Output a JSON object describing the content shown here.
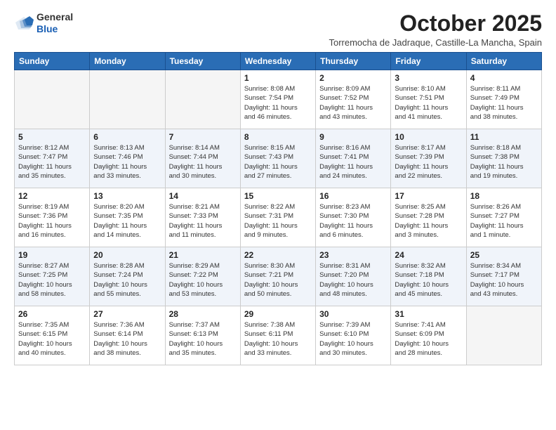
{
  "logo": {
    "general": "General",
    "blue": "Blue"
  },
  "title": "October 2025",
  "location": "Torremocha de Jadraque, Castille-La Mancha, Spain",
  "headers": [
    "Sunday",
    "Monday",
    "Tuesday",
    "Wednesday",
    "Thursday",
    "Friday",
    "Saturday"
  ],
  "weeks": [
    [
      {
        "day": "",
        "lines": []
      },
      {
        "day": "",
        "lines": []
      },
      {
        "day": "",
        "lines": []
      },
      {
        "day": "1",
        "lines": [
          "Sunrise: 8:08 AM",
          "Sunset: 7:54 PM",
          "Daylight: 11 hours",
          "and 46 minutes."
        ]
      },
      {
        "day": "2",
        "lines": [
          "Sunrise: 8:09 AM",
          "Sunset: 7:52 PM",
          "Daylight: 11 hours",
          "and 43 minutes."
        ]
      },
      {
        "day": "3",
        "lines": [
          "Sunrise: 8:10 AM",
          "Sunset: 7:51 PM",
          "Daylight: 11 hours",
          "and 41 minutes."
        ]
      },
      {
        "day": "4",
        "lines": [
          "Sunrise: 8:11 AM",
          "Sunset: 7:49 PM",
          "Daylight: 11 hours",
          "and 38 minutes."
        ]
      }
    ],
    [
      {
        "day": "5",
        "lines": [
          "Sunrise: 8:12 AM",
          "Sunset: 7:47 PM",
          "Daylight: 11 hours",
          "and 35 minutes."
        ]
      },
      {
        "day": "6",
        "lines": [
          "Sunrise: 8:13 AM",
          "Sunset: 7:46 PM",
          "Daylight: 11 hours",
          "and 33 minutes."
        ]
      },
      {
        "day": "7",
        "lines": [
          "Sunrise: 8:14 AM",
          "Sunset: 7:44 PM",
          "Daylight: 11 hours",
          "and 30 minutes."
        ]
      },
      {
        "day": "8",
        "lines": [
          "Sunrise: 8:15 AM",
          "Sunset: 7:43 PM",
          "Daylight: 11 hours",
          "and 27 minutes."
        ]
      },
      {
        "day": "9",
        "lines": [
          "Sunrise: 8:16 AM",
          "Sunset: 7:41 PM",
          "Daylight: 11 hours",
          "and 24 minutes."
        ]
      },
      {
        "day": "10",
        "lines": [
          "Sunrise: 8:17 AM",
          "Sunset: 7:39 PM",
          "Daylight: 11 hours",
          "and 22 minutes."
        ]
      },
      {
        "day": "11",
        "lines": [
          "Sunrise: 8:18 AM",
          "Sunset: 7:38 PM",
          "Daylight: 11 hours",
          "and 19 minutes."
        ]
      }
    ],
    [
      {
        "day": "12",
        "lines": [
          "Sunrise: 8:19 AM",
          "Sunset: 7:36 PM",
          "Daylight: 11 hours",
          "and 16 minutes."
        ]
      },
      {
        "day": "13",
        "lines": [
          "Sunrise: 8:20 AM",
          "Sunset: 7:35 PM",
          "Daylight: 11 hours",
          "and 14 minutes."
        ]
      },
      {
        "day": "14",
        "lines": [
          "Sunrise: 8:21 AM",
          "Sunset: 7:33 PM",
          "Daylight: 11 hours",
          "and 11 minutes."
        ]
      },
      {
        "day": "15",
        "lines": [
          "Sunrise: 8:22 AM",
          "Sunset: 7:31 PM",
          "Daylight: 11 hours",
          "and 9 minutes."
        ]
      },
      {
        "day": "16",
        "lines": [
          "Sunrise: 8:23 AM",
          "Sunset: 7:30 PM",
          "Daylight: 11 hours",
          "and 6 minutes."
        ]
      },
      {
        "day": "17",
        "lines": [
          "Sunrise: 8:25 AM",
          "Sunset: 7:28 PM",
          "Daylight: 11 hours",
          "and 3 minutes."
        ]
      },
      {
        "day": "18",
        "lines": [
          "Sunrise: 8:26 AM",
          "Sunset: 7:27 PM",
          "Daylight: 11 hours",
          "and 1 minute."
        ]
      }
    ],
    [
      {
        "day": "19",
        "lines": [
          "Sunrise: 8:27 AM",
          "Sunset: 7:25 PM",
          "Daylight: 10 hours",
          "and 58 minutes."
        ]
      },
      {
        "day": "20",
        "lines": [
          "Sunrise: 8:28 AM",
          "Sunset: 7:24 PM",
          "Daylight: 10 hours",
          "and 55 minutes."
        ]
      },
      {
        "day": "21",
        "lines": [
          "Sunrise: 8:29 AM",
          "Sunset: 7:22 PM",
          "Daylight: 10 hours",
          "and 53 minutes."
        ]
      },
      {
        "day": "22",
        "lines": [
          "Sunrise: 8:30 AM",
          "Sunset: 7:21 PM",
          "Daylight: 10 hours",
          "and 50 minutes."
        ]
      },
      {
        "day": "23",
        "lines": [
          "Sunrise: 8:31 AM",
          "Sunset: 7:20 PM",
          "Daylight: 10 hours",
          "and 48 minutes."
        ]
      },
      {
        "day": "24",
        "lines": [
          "Sunrise: 8:32 AM",
          "Sunset: 7:18 PM",
          "Daylight: 10 hours",
          "and 45 minutes."
        ]
      },
      {
        "day": "25",
        "lines": [
          "Sunrise: 8:34 AM",
          "Sunset: 7:17 PM",
          "Daylight: 10 hours",
          "and 43 minutes."
        ]
      }
    ],
    [
      {
        "day": "26",
        "lines": [
          "Sunrise: 7:35 AM",
          "Sunset: 6:15 PM",
          "Daylight: 10 hours",
          "and 40 minutes."
        ]
      },
      {
        "day": "27",
        "lines": [
          "Sunrise: 7:36 AM",
          "Sunset: 6:14 PM",
          "Daylight: 10 hours",
          "and 38 minutes."
        ]
      },
      {
        "day": "28",
        "lines": [
          "Sunrise: 7:37 AM",
          "Sunset: 6:13 PM",
          "Daylight: 10 hours",
          "and 35 minutes."
        ]
      },
      {
        "day": "29",
        "lines": [
          "Sunrise: 7:38 AM",
          "Sunset: 6:11 PM",
          "Daylight: 10 hours",
          "and 33 minutes."
        ]
      },
      {
        "day": "30",
        "lines": [
          "Sunrise: 7:39 AM",
          "Sunset: 6:10 PM",
          "Daylight: 10 hours",
          "and 30 minutes."
        ]
      },
      {
        "day": "31",
        "lines": [
          "Sunrise: 7:41 AM",
          "Sunset: 6:09 PM",
          "Daylight: 10 hours",
          "and 28 minutes."
        ]
      },
      {
        "day": "",
        "lines": []
      }
    ]
  ]
}
